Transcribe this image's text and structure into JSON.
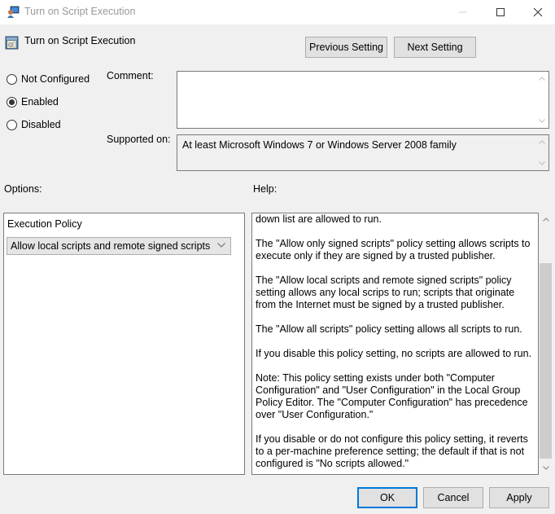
{
  "window": {
    "title": "Turn on Script Execution",
    "controls": {
      "minimize": "minimize",
      "maximize": "maximize",
      "close": "close"
    }
  },
  "header": {
    "policy_title": "Turn on Script Execution",
    "previous_setting": "Previous Setting",
    "next_setting": "Next Setting"
  },
  "state": {
    "options": [
      {
        "label": "Not Configured",
        "checked": false
      },
      {
        "label": "Enabled",
        "checked": true
      },
      {
        "label": "Disabled",
        "checked": false
      }
    ]
  },
  "comment": {
    "label": "Comment:",
    "value": ""
  },
  "supported": {
    "label": "Supported on:",
    "value": "At least Microsoft Windows 7 or Windows Server 2008 family"
  },
  "options_section": {
    "label": "Options:",
    "execution_policy_label": "Execution Policy",
    "execution_policy_value": "Allow local scripts and remote signed scripts"
  },
  "help_section": {
    "label": "Help:",
    "paragraphs": [
      "down list are allowed to run.",
      "The \"Allow only signed scripts\" policy setting allows scripts to execute only if they are signed by a trusted publisher.",
      "The \"Allow local scripts and remote signed scripts\" policy setting allows any local scrips to run; scripts that originate from the Internet must be signed by a trusted publisher.",
      "The \"Allow all scripts\" policy setting allows all scripts to run.",
      "If you disable this policy setting, no scripts are allowed to run.",
      "Note: This policy setting exists under both \"Computer Configuration\" and \"User Configuration\" in the Local Group Policy Editor. The \"Computer Configuration\" has precedence over \"User Configuration.\"",
      "If you disable or do not configure this policy setting, it reverts to a per-machine preference setting; the default if that is not configured is \"No scripts allowed.\""
    ]
  },
  "footer": {
    "ok": "OK",
    "cancel": "Cancel",
    "apply": "Apply"
  }
}
